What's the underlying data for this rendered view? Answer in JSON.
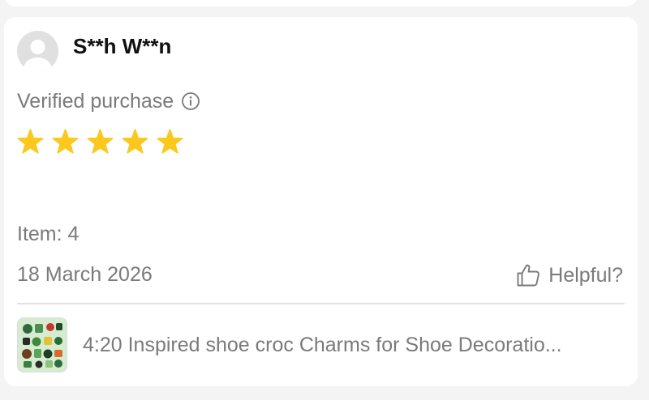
{
  "review": {
    "reviewer_name": "S**h W**n",
    "verified_label": "Verified purchase",
    "rating": 5,
    "rating_max": 5,
    "item_label": "Item: 4",
    "date": "18 March 2026",
    "helpful_label": "Helpful?"
  },
  "product": {
    "title": "4:20 Inspired shoe croc Charms for Shoe Decoratio..."
  },
  "colors": {
    "star": "#fbc81b",
    "muted_text": "#7a7a7a",
    "name_text": "#111111",
    "divider": "#e2e2e2",
    "avatar_bg": "#e0e0e0"
  },
  "icons": {
    "avatar": "person-silhouette-icon",
    "info": "info-circle-icon",
    "star": "star-icon",
    "helpful": "thumbs-up-icon"
  }
}
